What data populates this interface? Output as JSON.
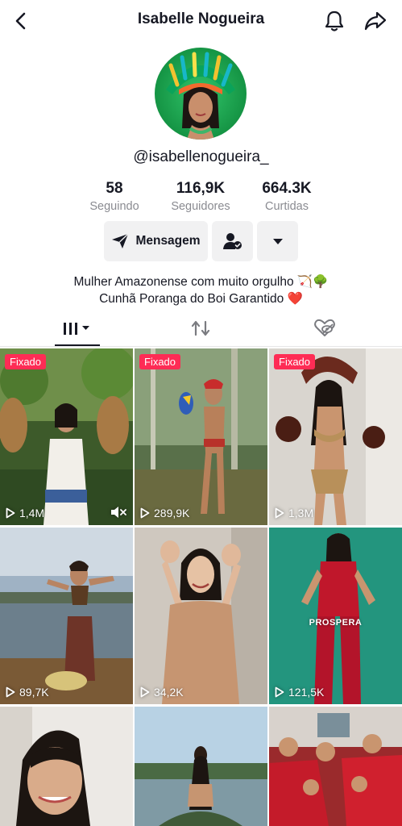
{
  "header": {
    "title": "Isabelle Nogueira",
    "back_icon": "chevron-left-icon",
    "bell_icon": "bell-icon",
    "share_icon": "share-arrow-icon"
  },
  "profile": {
    "handle": "@isabellenogueira_",
    "avatar_icon": "avatar-photo"
  },
  "stats": [
    {
      "value": "58",
      "label": "Seguindo"
    },
    {
      "value": "116,9K",
      "label": "Seguidores"
    },
    {
      "value": "664.3K",
      "label": "Curtidas"
    }
  ],
  "actions": {
    "message_label": "Mensagem",
    "message_icon": "send-icon",
    "follow_icon": "person-check-icon",
    "more_icon": "caret-down-icon"
  },
  "bio": {
    "line1": "Mulher Amazonense com muito orgulho 🏹🌳",
    "line2": "Cunhã Poranga do Boi Garantido ❤️"
  },
  "tabs": [
    {
      "name": "videos",
      "icon": "grid-bars-icon",
      "active": true
    },
    {
      "name": "reposts",
      "icon": "repost-icon",
      "active": false
    },
    {
      "name": "liked",
      "icon": "hidden-heart-icon",
      "active": false
    }
  ],
  "colors": {
    "accent": "#fe2c55",
    "text": "#161823",
    "muted": "#8a8b91",
    "button_bg": "#f1f1f2"
  },
  "videos": [
    {
      "views": "1,4M",
      "pinned_label": "Fixado",
      "muted": true
    },
    {
      "views": "289,9K",
      "pinned_label": "Fixado"
    },
    {
      "views": "1,3M",
      "pinned_label": "Fixado"
    },
    {
      "views": "89,7K"
    },
    {
      "views": "34,2K"
    },
    {
      "views": "121,5K",
      "overlay_text": "PROSPERA"
    },
    {
      "views": ""
    },
    {
      "views": ""
    },
    {
      "views": ""
    }
  ]
}
